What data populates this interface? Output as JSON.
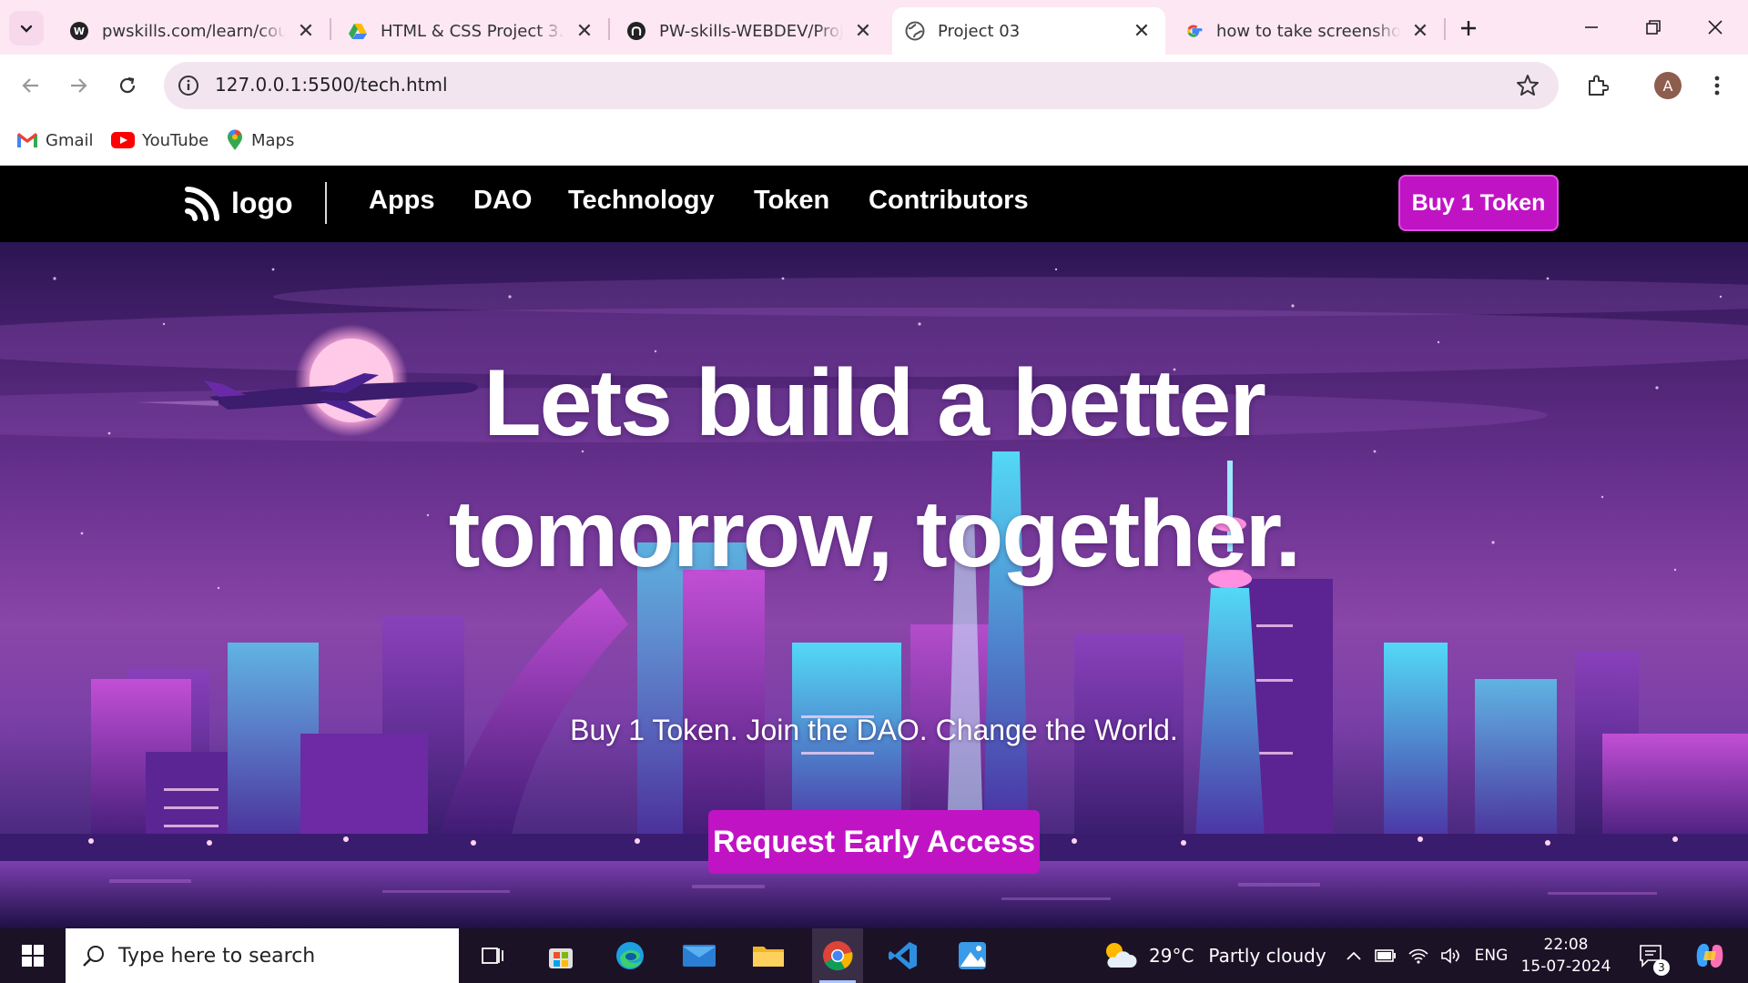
{
  "browser": {
    "tabs": [
      {
        "title": "pwskills.com/learn/course",
        "icon": "pwskills-icon",
        "active": false
      },
      {
        "title": "HTML & CSS Project 3.pdf",
        "icon": "google-drive-icon",
        "active": false
      },
      {
        "title": "PW-skills-WEBDEV/Project",
        "icon": "github-icon",
        "active": false
      },
      {
        "title": "Project 03",
        "icon": "globe-icon",
        "active": true
      },
      {
        "title": "how to take screenshot in",
        "icon": "google-icon",
        "active": false
      }
    ],
    "url": "127.0.0.1:5500/tech.html",
    "profile_initial": "A",
    "bookmarks": [
      "Gmail",
      "YouTube",
      "Maps"
    ]
  },
  "site": {
    "logo_text": "logo",
    "nav": [
      "Apps",
      "DAO",
      "Technology",
      "Token",
      "Contributors"
    ],
    "buy_button": "Buy 1 Token",
    "hero": {
      "title_line1": "Lets build a better",
      "title_line2": "tomorrow, together.",
      "subtitle": "Buy 1 Token. Join the DAO. Change the World.",
      "cta": "Request Early Access"
    },
    "accent_color": "#c014c4"
  },
  "taskbar": {
    "search_placeholder": "Type here to search",
    "weather_temp": "29°C",
    "weather_desc": "Partly cloudy",
    "language": "ENG",
    "time": "22:08",
    "date": "15-07-2024",
    "notification_count": "3"
  }
}
